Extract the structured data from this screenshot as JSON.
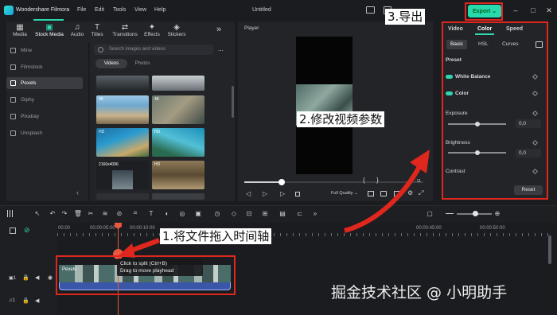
{
  "app": {
    "name": "Wondershare Filmora",
    "menu": [
      "File",
      "Edit",
      "Tools",
      "View",
      "Help"
    ],
    "document_title": "Untitled",
    "export_label": "Export ⌄",
    "window_controls": [
      "minimize-icon",
      "maximize-icon",
      "close-icon"
    ]
  },
  "media_tabs": [
    {
      "label": "Media",
      "icon": "media-icon",
      "glyph": "▦"
    },
    {
      "label": "Stock Media",
      "icon": "stock-media-icon",
      "glyph": "▣"
    },
    {
      "label": "Audio",
      "icon": "audio-icon",
      "glyph": "♫"
    },
    {
      "label": "Titles",
      "icon": "titles-icon",
      "glyph": "T"
    },
    {
      "label": "Transitions",
      "icon": "transitions-icon",
      "glyph": "⇄"
    },
    {
      "label": "Effects",
      "icon": "effects-icon",
      "glyph": "✦"
    },
    {
      "label": "Stickers",
      "icon": "stickers-icon",
      "glyph": "◈"
    }
  ],
  "media_more": "»",
  "sidebar": {
    "items": [
      {
        "label": "Mine"
      },
      {
        "label": "Filmstock"
      },
      {
        "label": "Pexels",
        "active": true
      },
      {
        "label": "Giphy"
      },
      {
        "label": "Pixabay"
      },
      {
        "label": "Unsplash"
      }
    ],
    "collapse": "‹"
  },
  "media_browser": {
    "search_placeholder": "Search images and videos",
    "more": "...",
    "filters": [
      "Videos",
      "Photos"
    ],
    "thumbnail_badges": [
      "4K",
      "4K",
      "HD",
      "HD",
      "HD",
      "2160x4096"
    ]
  },
  "player": {
    "label": "Player",
    "quality": "Full Quality ⌄",
    "bracket_in": "{",
    "bracket_out": "}",
    "tail_digits": ":11",
    "progress_fraction": 0.21
  },
  "properties": {
    "tabs": [
      "Video",
      "Color",
      "Speed"
    ],
    "active_tab": "Color",
    "subtabs": [
      "Basic",
      "HSL",
      "Curves"
    ],
    "active_subtab": "Basic",
    "preset_label": "Preset",
    "white_balance": "White Balance",
    "color": "Color",
    "exposure": {
      "label": "Exposure",
      "value": "0,0",
      "position": 0.5
    },
    "brightness": {
      "label": "Brightness",
      "value": "0,0",
      "position": 0.5
    },
    "contrast": {
      "label": "Contrast"
    },
    "reset_label": "Reset"
  },
  "timeline": {
    "ruler_labels": [
      "00:00",
      "00:00:05:00",
      "00:00:10:00",
      "00:00:45:00",
      "00:00:50:00"
    ],
    "clip_title": "Pexels",
    "tooltip": [
      "Click to split (Ctrl+B)",
      "Drag to move playhead"
    ]
  },
  "annotations": {
    "export": "3.导出",
    "adjust": "2.修改视频参数",
    "drag": "1.将文件拖入时间轴"
  },
  "watermark": "掘金技术社区 @ 小明助手",
  "colors": {
    "accent": "#2fd6b0",
    "export": "#27d9ac",
    "annotation_red": "#e0271e",
    "playhead": "#e8583e",
    "clip": "#3a56a8"
  }
}
